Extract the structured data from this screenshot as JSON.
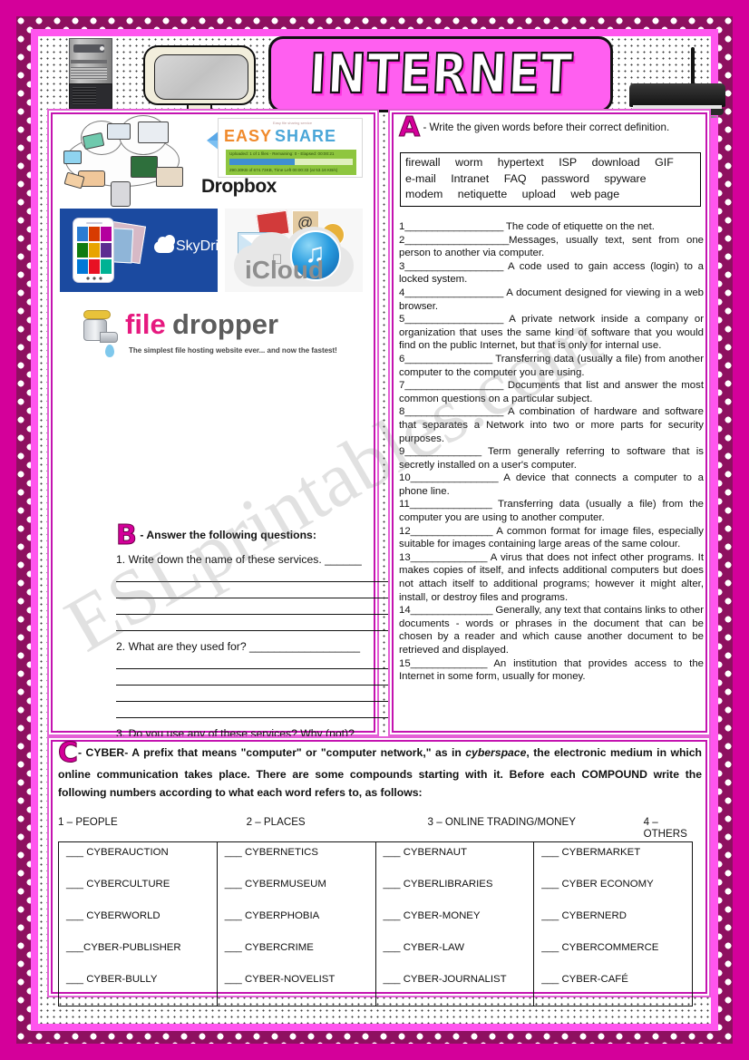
{
  "page": {
    "title": "INTERNET",
    "watermark": "ESLprintables.com"
  },
  "header": {
    "icons": [
      "pc-tower-icon",
      "crt-monitor-icon",
      "wifi-router-icon"
    ]
  },
  "services": {
    "cloud_devices_label": "cloud-devices-illustration",
    "dropbox": {
      "name": "Dropbox"
    },
    "easyshare": {
      "word1": "EASY",
      "word2": "SHARE",
      "tagline": "Easy file sharing service",
      "status_top": "Uploaded: 1 of 1 files - Remaining: 0 - Elapsed: 00:00:21",
      "status_bottom": "290.30KB of 674.73KB, Time Left 00:00:33 (at 53.16 KB/s)"
    },
    "skydrive": {
      "name": "SkyDrive"
    },
    "icloud": {
      "name": "iCloud"
    },
    "filedropper": {
      "word1": "file",
      "word2": "dropper",
      "tagline": "The simplest file hosting website ever... and now the fastest!"
    }
  },
  "sectionA": {
    "letter": "A",
    "instruction": "-  Write  the  given  words  before  their  correct  definition.",
    "wordbank": [
      [
        "firewall",
        "worm",
        "hypertext",
        "ISP",
        "download",
        "GIF"
      ],
      [
        "e-mail",
        "Intranet",
        "FAQ",
        "password",
        "spyware"
      ],
      [
        "modem",
        "netiquette",
        "upload",
        "web page"
      ]
    ],
    "definitions": [
      {
        "n": "1",
        "blank": "__________________",
        "text": " The code of etiquette on the net."
      },
      {
        "n": "2",
        "blank": "___________________",
        "text": "Messages, usually text, sent from one person to another via computer."
      },
      {
        "n": "3",
        "blank": "__________________",
        "text": " A code used to gain access (login) to a locked system."
      },
      {
        "n": "4",
        "blank": "__________________",
        "text": " A document designed for viewing in a web browser."
      },
      {
        "n": "5",
        "blank": "__________________",
        "text": " A private network inside a company or organization that uses the same kind of software that you would find on the public Internet, but that is only for internal use."
      },
      {
        "n": "6",
        "blank": "________________",
        "text": " Transferring data (usually a file) from another computer to the computer you are using."
      },
      {
        "n": "7",
        "blank": "__________________",
        "text": " Documents that list and answer the most common questions on a particular subject."
      },
      {
        "n": "8",
        "blank": "__________________",
        "text": " A combination of hardware and software that separates a Network into two or more parts for security purposes."
      },
      {
        "n": "9",
        "blank": "______________",
        "text": " Term generally referring to software that is secretly installed on a user's computer."
      },
      {
        "n": "10",
        "blank": "________________",
        "text": " A device that connects a computer to a phone line."
      },
      {
        "n": "11",
        "blank": "_______________",
        "text": " Transferring data (usually a file) from the computer you are using to another computer."
      },
      {
        "n": "12",
        "blank": "_______________",
        "text": " A common format for image files, especially suitable for images containing large areas of the same colour."
      },
      {
        "n": "13",
        "blank": "______________",
        "text": " A virus that does not infect other programs. It makes copies of itself, and infects additional computers but does not attach itself to additional programs; however it might alter, install, or destroy files and programs."
      },
      {
        "n": "14",
        "blank": "_______________",
        "text": " Generally, any text that contains links to other documents - words or phrases in the document that can be chosen by a reader and which cause another document to be retrieved and displayed."
      },
      {
        "n": "15",
        "blank": "______________",
        "text": " An institution that provides access to the Internet in some form, usually for money."
      }
    ]
  },
  "sectionB": {
    "letter": "B",
    "instruction": "-  Answer the following questions:",
    "questions": [
      {
        "n": "1.",
        "text": "Write down the name of these services. ______"
      },
      {
        "n": "2.",
        "text": "What are they used for? __________________"
      },
      {
        "n": "3.",
        "text": "Do you use any of these services? Why (not)?"
      }
    ]
  },
  "sectionC": {
    "letter": "C",
    "text_part1": "-  CYBER-   A prefix that means \"computer\" or \"computer network,\" as in ",
    "italic_word": "cyberspace",
    "text_part2": ", the electronic medium in which online communication takes place. There are some compounds starting with it. Before each COMPOUND write the following numbers according to what each word refers to, as follows:",
    "categories": [
      "1 – PEOPLE",
      "2 – PLACES",
      "3 – ONLINE TRADING/MONEY",
      "4 – OTHERS"
    ],
    "blank": "___",
    "columns": [
      [
        "CYBERAUCTION",
        "CYBERCULTURE",
        "CYBERWORLD",
        "CYBER-PUBLISHER",
        "CYBER-BULLY"
      ],
      [
        "CYBERNETICS",
        "CYBERMUSEUM",
        "CYBERPHOBIA",
        "CYBERCRIME",
        "CYBER-NOVELIST"
      ],
      [
        "CYBERNAUT",
        "CYBERLIBRARIES",
        "CYBER-MONEY",
        "CYBER-LAW",
        "CYBER-JOURNALIST"
      ],
      [
        "CYBERMARKET",
        "CYBER ECONOMY",
        "CYBERNERD",
        "CYBERCOMMERCE",
        "CYBER-CAFÉ"
      ]
    ]
  },
  "colors": {
    "frame_outer": "#d4009a",
    "frame_pink": "#ff55ee",
    "panel_border": "#c414b0",
    "title_fill": "#ff5ff0",
    "accent": "#d4009a"
  }
}
